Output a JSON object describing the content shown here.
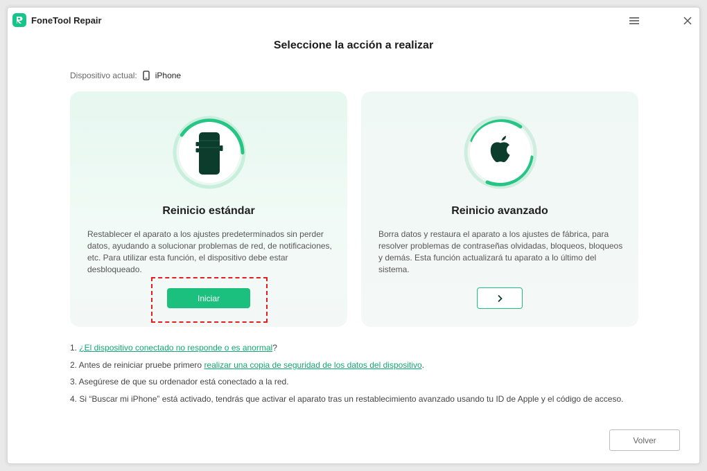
{
  "window": {
    "title": "FoneTool Repair"
  },
  "page": {
    "title": "Seleccione la acción a realizar",
    "device_label": "Dispositivo actual:",
    "device_name": "iPhone"
  },
  "cards": {
    "standard": {
      "title": "Reinicio estándar",
      "description": "Restablecer el aparato a los ajustes predeterminados sin perder datos, ayudando a solucionar problemas de red, de notificaciones, etc. Para utilizar esta función, el dispositivo debe estar desbloqueado.",
      "button_label": "Iniciar",
      "icon": "phone-icon"
    },
    "advanced": {
      "title": "Reinicio avanzado",
      "description": "Borra datos y restaura el aparato a los ajustes de fábrica, para resolver problemas de contraseñas olvidadas, bloqueos, bloqueos y demás. Esta función actualizará tu aparato a lo último del sistema.",
      "button_icon": "chevron-right-icon",
      "icon": "apple-icon"
    }
  },
  "notes": {
    "n1": {
      "prefix": "1. ",
      "link": "¿El dispositivo conectado no responde o es anormal",
      "suffix": "?"
    },
    "n2": {
      "prefix": "2. Antes de reiniciar pruebe primero ",
      "link": "realizar una copia de seguridad de los datos del dispositivo",
      "suffix": "."
    },
    "n3": {
      "text": "3. Asegúrese de que su ordenador está conectado a la red."
    },
    "n4": {
      "text": "4. Si  “Buscar mi iPhone”  está activado, tendrás que activar el aparato tras un restablecimiento avanzado usando tu ID de Apple y el código de acceso."
    }
  },
  "footer": {
    "back_label": "Volver"
  },
  "colors": {
    "accent": "#1cc07e",
    "link": "#11a86f",
    "highlight": "#e31c1c"
  }
}
